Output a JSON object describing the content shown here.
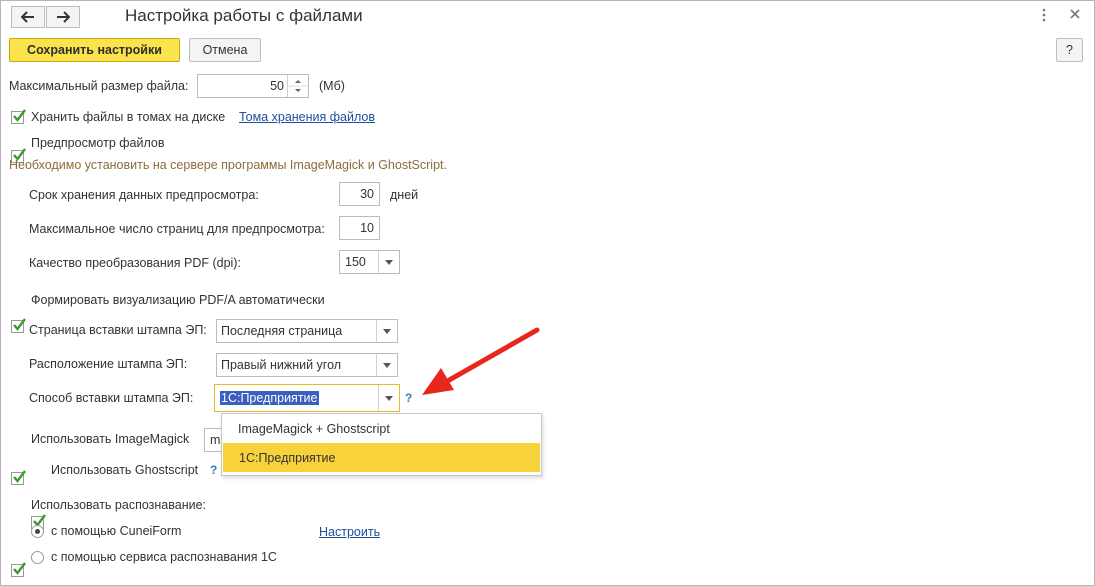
{
  "window": {
    "title": "Настройка работы с файлами"
  },
  "toolbar": {
    "save_label": "Сохранить настройки",
    "cancel_label": "Отмена",
    "help_label": "?"
  },
  "max_size": {
    "label": "Максимальный размер файла:",
    "value": "50",
    "unit": "(Мб)"
  },
  "volumes": {
    "label": "Хранить файлы в томах на диске",
    "link": "Тома хранения файлов",
    "checked": true
  },
  "preview": {
    "label": "Предпросмотр файлов",
    "checked": true,
    "hint": "Необходимо установить на сервере программы ImageMagick и GhostScript.",
    "retention_label": "Срок хранения данных предпросмотра:",
    "retention_value": "30",
    "retention_unit": "дней",
    "pages_label": "Максимальное число страниц для предпросмотра:",
    "pages_value": "10",
    "quality_label": "Качество преобразования PDF (dpi):",
    "quality_value": "150"
  },
  "pdfa": {
    "label": "Формировать визуализацию PDF/A автоматически",
    "checked": true,
    "page_label": "Страница вставки штампа ЭП:",
    "page_value": "Последняя страница",
    "position_label": "Расположение штампа ЭП:",
    "position_value": "Правый нижний угол",
    "method_label": "Способ вставки штампа ЭП:",
    "method_value": "1С:Предприятие",
    "method_help": "?"
  },
  "dropdown": {
    "options": [
      "ImageMagick + Ghostscript",
      "1С:Предприятие"
    ],
    "selected": "1С:Предприятие"
  },
  "imagemagick": {
    "label": "Использовать ImageMagick",
    "checked": true,
    "field_value_visible": "m"
  },
  "ghostscript": {
    "label": "Использовать Ghostscript",
    "checked": true,
    "help": "?"
  },
  "recognition": {
    "label": "Использовать распознавание:",
    "checked": true,
    "option1": "с помощью CuneiForm",
    "option2": "с помощью сервиса распознавания 1С",
    "configure_link": "Настроить",
    "selected": "option1"
  },
  "colors": {
    "accent_yellow": "#fbe34c",
    "selection_yellow": "#f7d23b",
    "check_green": "#3a9a2a",
    "link_blue": "#1d4f9e",
    "arrow_red": "#e8261c"
  }
}
